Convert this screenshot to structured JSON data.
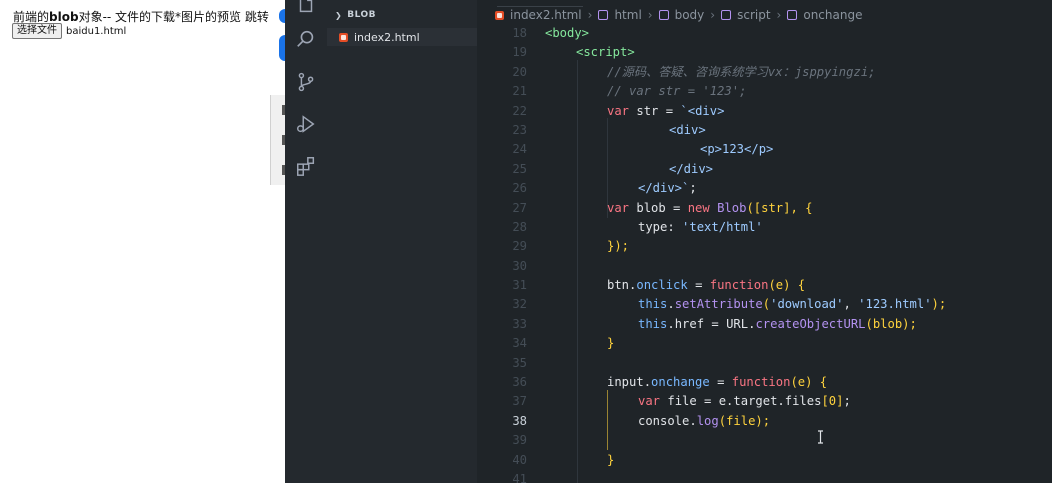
{
  "browser": {
    "title_part1": "前端的",
    "title_bold": "blob",
    "title_part2": "对象-- 文件的下载*图片的预览 跳转",
    "file_button": "选择文件",
    "file_name": "baidu1.html"
  },
  "explorer": {
    "section": "BLOB",
    "file": "index2.html"
  },
  "breadcrumb": {
    "file": "index2.html",
    "c1": "html",
    "c2": "body",
    "c3": "script",
    "c4": "onchange"
  },
  "code": {
    "numbers": [
      "18",
      "19",
      "20",
      "21",
      "22",
      "23",
      "24",
      "25",
      "26",
      "27",
      "28",
      "29",
      "30",
      "31",
      "32",
      "33",
      "34",
      "35",
      "36",
      "37",
      "38",
      "39",
      "40",
      "41"
    ],
    "active_line": "38",
    "l18_a": "<body>",
    "l19_a": "<script>",
    "l20": "//源码、答疑、咨询系统学习vx：jsppyingzi;",
    "l21": "// var str = '123';",
    "l22_kw": "var",
    "l22_var": " str = ",
    "l22_str": "`<div>",
    "l23": "<div>",
    "l24": "<p>123</p>",
    "l25": "</div>",
    "l26_a": "</div>`",
    "l26_b": ";",
    "l27_kw": "var",
    "l27_var": " blob = ",
    "l27_new": "new",
    "l27_fn": "Blob",
    "l27_rest": "([str], {",
    "l28_key": "type",
    "l28_colon": ": ",
    "l28_str": "'text/html'",
    "l29": "});",
    "l31_obj": "btn",
    "l31_dot": ".",
    "l31_prop": "onclick",
    "l31_eq": " = ",
    "l31_fn": "function",
    "l31_rest": "(e) {",
    "l32_this": "this",
    "l32_dot": ".",
    "l32_fn": "setAttribute",
    "l32_p1": "(",
    "l32_s1": "'download'",
    "l32_c": ", ",
    "l32_s2": "'123.html'",
    "l32_end": ");",
    "l33_this": "this",
    "l33_dot": ".",
    "l33_prop": "href",
    "l33_eq": " = ",
    "l33_url": "URL",
    "l33_dot2": ".",
    "l33_fn": "createObjectURL",
    "l33_rest": "(blob);",
    "l34": "}",
    "l36_obj": "input",
    "l36_dot": ".",
    "l36_prop": "onchange",
    "l36_eq": " = ",
    "l36_fn": "function",
    "l36_rest": "(e) {",
    "l37_kw": "var",
    "l37_rest": " file = e.target.files",
    "l37_idx": "[0]",
    "l37_end": ";",
    "l38_obj": "console",
    "l38_dot": ".",
    "l38_fn": "log",
    "l38_rest": "(file);",
    "l40": "}"
  }
}
